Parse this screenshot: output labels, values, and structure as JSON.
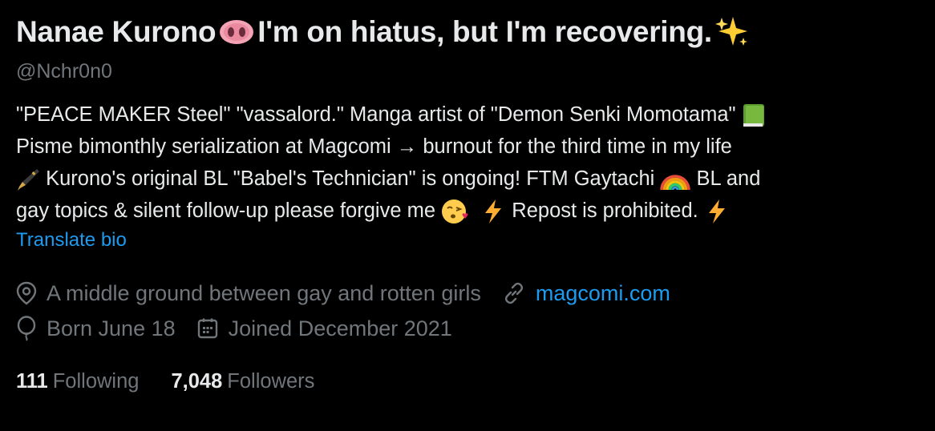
{
  "profile": {
    "name": "Nanae Kurono",
    "name_suffix": "I'm on hiatus, but I'm recovering.",
    "handle": "@Nchr0n0",
    "bio_lines": [
      "\"PEACE MAKER Steel\" \"vassalord.\" Manga artist of \"Demon Senki Momotama\"",
      "Pisme bimonthly serialization at Magcomi → burnout for the third time in my life",
      "Kurono's original BL \"Babel's Technician\" is ongoing! FTM Gaytachi",
      "BL and",
      "gay topics & silent follow-up please forgive me",
      "Repost is prohibited."
    ],
    "translate_label": "Translate bio",
    "location": "A middle ground between gay and rotten girls",
    "website": "magcomi.com",
    "birthday": "Born June 18",
    "joined": "Joined December 2021",
    "following_count": "111",
    "following_label": "Following",
    "followers_count": "7,048",
    "followers_label": "Followers"
  },
  "icons": {
    "name_emoji_1": "pig-nose-icon",
    "name_emoji_2": "sparkles-icon",
    "bio_emoji_book": "green-book-icon",
    "bio_emoji_pen": "fountain-pen-icon",
    "bio_emoji_rainbow": "rainbow-icon",
    "bio_emoji_kiss": "face-blowing-kiss-icon",
    "bio_emoji_zap": "high-voltage-icon",
    "location": "location-pin-icon",
    "link": "link-icon",
    "birthday": "balloon-icon",
    "calendar": "calendar-icon"
  },
  "colors": {
    "background": "#000000",
    "text_primary": "#e7e9ea",
    "text_secondary": "#71767b",
    "accent": "#1d9bf0"
  }
}
